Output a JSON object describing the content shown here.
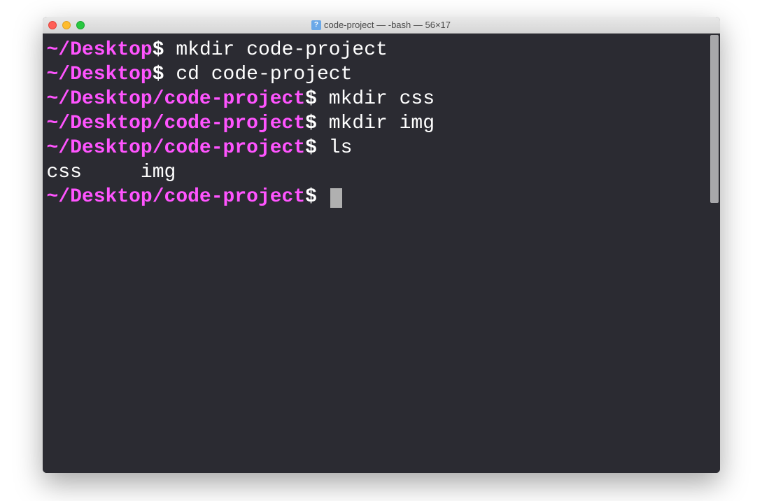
{
  "window": {
    "title": "code-project — -bash — 56×17",
    "doc_icon_label": "?"
  },
  "colors": {
    "prompt": "#ff54ff",
    "bg": "#2b2b32",
    "fg": "#ffffff"
  },
  "session": {
    "lines": [
      {
        "prompt": "~/Desktop",
        "dollar": "$",
        "cmd": " mkdir code-project"
      },
      {
        "prompt": "~/Desktop",
        "dollar": "$",
        "cmd": " cd code-project"
      },
      {
        "prompt": "~/Desktop/code-project",
        "dollar": "$",
        "cmd": " mkdir css"
      },
      {
        "prompt": "~/Desktop/code-project",
        "dollar": "$",
        "cmd": " mkdir img"
      },
      {
        "prompt": "~/Desktop/code-project",
        "dollar": "$",
        "cmd": " ls"
      }
    ],
    "output": "css     img",
    "current_prompt": "~/Desktop/code-project",
    "current_dollar": "$"
  }
}
